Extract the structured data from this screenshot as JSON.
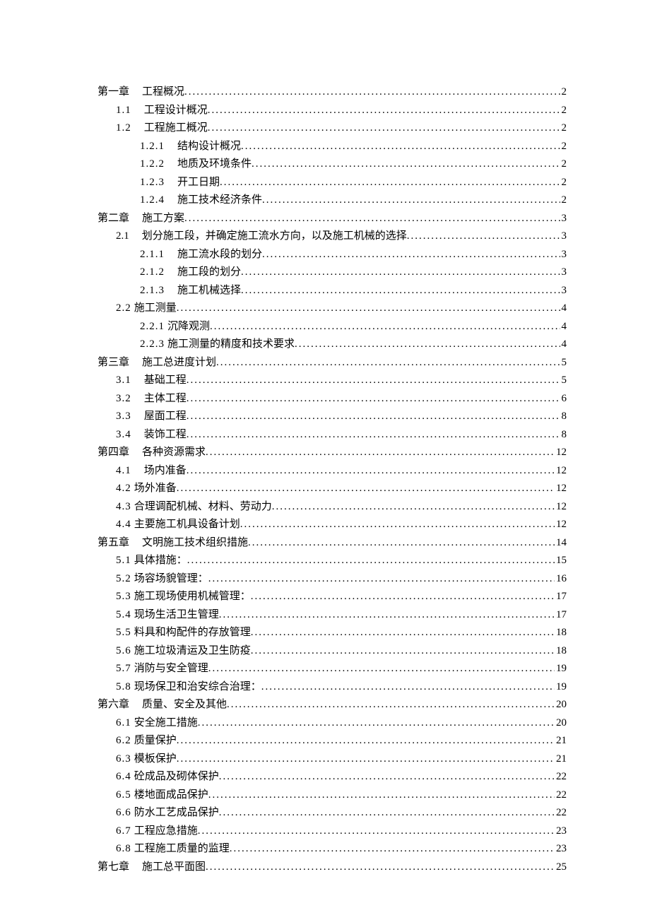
{
  "toc": [
    {
      "level": 0,
      "label": "第一章",
      "labelClass": "chapter-label",
      "title": "工程概况",
      "page": "2"
    },
    {
      "level": 1,
      "label": "1.1",
      "labelClass": "sec-label label-spacing",
      "title": "工程设计概况",
      "page": "2"
    },
    {
      "level": 1,
      "label": "1.2",
      "labelClass": "sec-label label-spacing",
      "title": "工程施工概况",
      "page": "2"
    },
    {
      "level": 2,
      "label": "1.2.1",
      "labelClass": "sub-label label-spacing",
      "title": "结构设计概况",
      "page": "2"
    },
    {
      "level": 2,
      "label": "1.2.2",
      "labelClass": "sub-label label-spacing",
      "title": "地质及环境条件",
      "page": "2"
    },
    {
      "level": 2,
      "label": "1.2.3",
      "labelClass": "sub-label label-spacing",
      "title": "开工日期",
      "page": "2"
    },
    {
      "level": 2,
      "label": "1.2.4",
      "labelClass": "sub-label label-spacing",
      "title": "施工技术经济条件",
      "page": "2"
    },
    {
      "level": 0,
      "label": "第二章",
      "labelClass": "chapter-label",
      "title": "施工方案",
      "page": "3"
    },
    {
      "level": 1,
      "label": "2.1",
      "labelClass": "sec-label",
      "title": "划分施工段，并确定施工流水方向，以及施工机械的选择",
      "page": "3"
    },
    {
      "level": 2,
      "label": "2.1.1",
      "labelClass": "sub-label label-spacing",
      "title": "施工流水段的划分",
      "page": "3"
    },
    {
      "level": 2,
      "label": "2.1.2",
      "labelClass": "sub-label label-spacing",
      "title": "施工段的划分",
      "page": "3"
    },
    {
      "level": 2,
      "label": "2.1.3",
      "labelClass": "sub-label label-spacing",
      "title": "施工机械选择",
      "page": "3"
    },
    {
      "level": 1,
      "label": "2.2",
      "labelClass": "sec-label-tight label-spacing",
      "title": "施工测量",
      "page": "4"
    },
    {
      "level": 2,
      "label": "2.2.1",
      "labelClass": "sec-label-tight label-spacing",
      "title": "沉降观测",
      "page": "4"
    },
    {
      "level": 2,
      "label": "2.2.3",
      "labelClass": "sec-label-tight label-spacing",
      "title": "施工测量的精度和技术要求",
      "page": "4"
    },
    {
      "level": 0,
      "label": "第三章",
      "labelClass": "chapter-label",
      "title": "施工总进度计划",
      "page": "5"
    },
    {
      "level": 1,
      "label": "3.1",
      "labelClass": "sec-label label-spacing",
      "title": "基础工程",
      "page": "5"
    },
    {
      "level": 1,
      "label": "3.2",
      "labelClass": "sec-label label-spacing",
      "title": "主体工程",
      "page": "6"
    },
    {
      "level": 1,
      "label": "3.3",
      "labelClass": "sec-label label-spacing",
      "title": "屋面工程",
      "page": "8"
    },
    {
      "level": 1,
      "label": "3.4",
      "labelClass": "sec-label label-spacing",
      "title": "装饰工程",
      "page": "8"
    },
    {
      "level": 0,
      "label": "第四章",
      "labelClass": "chapter-label",
      "title": "各种资源需求",
      "page": "12"
    },
    {
      "level": 1,
      "label": "4.1",
      "labelClass": "sec-label label-spacing",
      "title": "场内准备",
      "page": "12"
    },
    {
      "level": 1,
      "label": "4.2",
      "labelClass": "sec-label-tight label-spacing",
      "title": "场外准备",
      "page": "12"
    },
    {
      "level": 1,
      "label": "4.3",
      "labelClass": "sec-label-tight label-spacing",
      "title": "合理调配机械、材料、劳动力",
      "page": "12"
    },
    {
      "level": 1,
      "label": "4.4",
      "labelClass": "sec-label-tight label-spacing",
      "title": "主要施工机具设备计划",
      "page": "12"
    },
    {
      "level": 0,
      "label": "第五章",
      "labelClass": "chapter-label",
      "title": "文明施工技术组织措施",
      "page": "14"
    },
    {
      "level": 1,
      "label": "5.1",
      "labelClass": "sec-label-tight label-spacing",
      "title": "具体措施：",
      "page": "15"
    },
    {
      "level": 1,
      "label": "5.2",
      "labelClass": "sec-label-tight label-spacing",
      "title": "场容场貌管理：",
      "page": "16"
    },
    {
      "level": 1,
      "label": "5.3",
      "labelClass": "sec-label-tight label-spacing",
      "title": "施工现场使用机械管理：",
      "page": "17"
    },
    {
      "level": 1,
      "label": "5.4",
      "labelClass": "sec-label-tight label-spacing",
      "title": "现场生活卫生管理",
      "page": "17"
    },
    {
      "level": 1,
      "label": "5.5",
      "labelClass": "sec-label-tight label-spacing",
      "title": "料具和构配件的存放管理",
      "page": "18"
    },
    {
      "level": 1,
      "label": "5.6",
      "labelClass": "sec-label-tight label-spacing",
      "title": "施工垃圾清运及卫生防疫",
      "page": "18"
    },
    {
      "level": 1,
      "label": "5.7",
      "labelClass": "sec-label-tight label-spacing",
      "title": "消防与安全管理",
      "page": "19"
    },
    {
      "level": 1,
      "label": "5.8",
      "labelClass": "sec-label-tight label-spacing",
      "title": "现场保卫和治安综合治理：",
      "page": "19"
    },
    {
      "level": 0,
      "label": "第六章",
      "labelClass": "chapter-label",
      "title": "质量、安全及其他",
      "page": "20"
    },
    {
      "level": 1,
      "label": "6.1",
      "labelClass": "sec-label-tight label-spacing",
      "title": "安全施工措施",
      "page": "20"
    },
    {
      "level": 1,
      "label": "6.2",
      "labelClass": "sec-label-tight label-spacing",
      "title": "质量保护",
      "page": "21"
    },
    {
      "level": 1,
      "label": "6.3",
      "labelClass": "sec-label-tight label-spacing",
      "title": "模板保护",
      "page": "21"
    },
    {
      "level": 1,
      "label": "6.4",
      "labelClass": "sec-label-tight label-spacing",
      "title": "砼成品及砌体保护",
      "page": "22"
    },
    {
      "level": 1,
      "label": "6.5",
      "labelClass": "sec-label-tight label-spacing",
      "title": "楼地面成品保护",
      "page": "22"
    },
    {
      "level": 1,
      "label": "6.6",
      "labelClass": "sec-label-tight label-spacing",
      "title": "防水工艺成品保护",
      "page": "22"
    },
    {
      "level": 1,
      "label": "6.7",
      "labelClass": "sec-label-tight label-spacing",
      "title": "工程应急措施",
      "page": "23"
    },
    {
      "level": 1,
      "label": "6.8",
      "labelClass": "sec-label-tight label-spacing",
      "title": "工程施工质量的监理",
      "page": "23"
    },
    {
      "level": 0,
      "label": "第七章",
      "labelClass": "chapter-label",
      "title": "施工总平面图",
      "page": "25"
    }
  ]
}
